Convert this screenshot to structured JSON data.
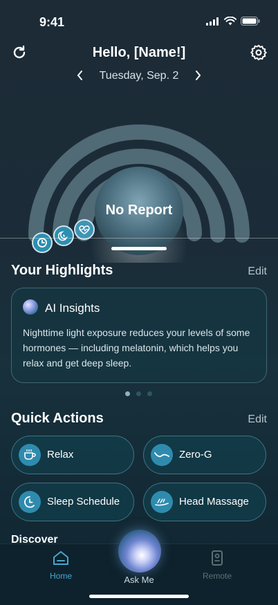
{
  "status_bar": {
    "time": "9:41"
  },
  "header": {
    "greeting": "Hello, [Name!]",
    "date": "Tuesday, Sep. 2"
  },
  "report": {
    "status": "No Report"
  },
  "highlights": {
    "title": "Your Highlights",
    "edit_label": "Edit",
    "card": {
      "title": "AI Insights",
      "text": "Nighttime light exposure reduces your levels of some hormones — including melatonin, which helps you relax and get deep sleep."
    },
    "pager": {
      "count": 3,
      "active_index": 0
    }
  },
  "quick_actions": {
    "title": "Quick Actions",
    "edit_label": "Edit",
    "items": [
      {
        "label": "Relax",
        "icon": "tea-cup-icon"
      },
      {
        "label": "Zero-G",
        "icon": "zero-g-icon"
      },
      {
        "label": "Sleep Schedule",
        "icon": "sleep-schedule-icon"
      },
      {
        "label": "Head Massage",
        "icon": "head-massage-icon"
      }
    ]
  },
  "discover": {
    "title": "Discover"
  },
  "bottom_nav": {
    "home": "Home",
    "ask": "Ask Me",
    "remote": "Remote"
  },
  "colors": {
    "accent": "#2f8bae",
    "nav_active": "#4aa6cf",
    "nav_inactive": "#5f6f76"
  }
}
